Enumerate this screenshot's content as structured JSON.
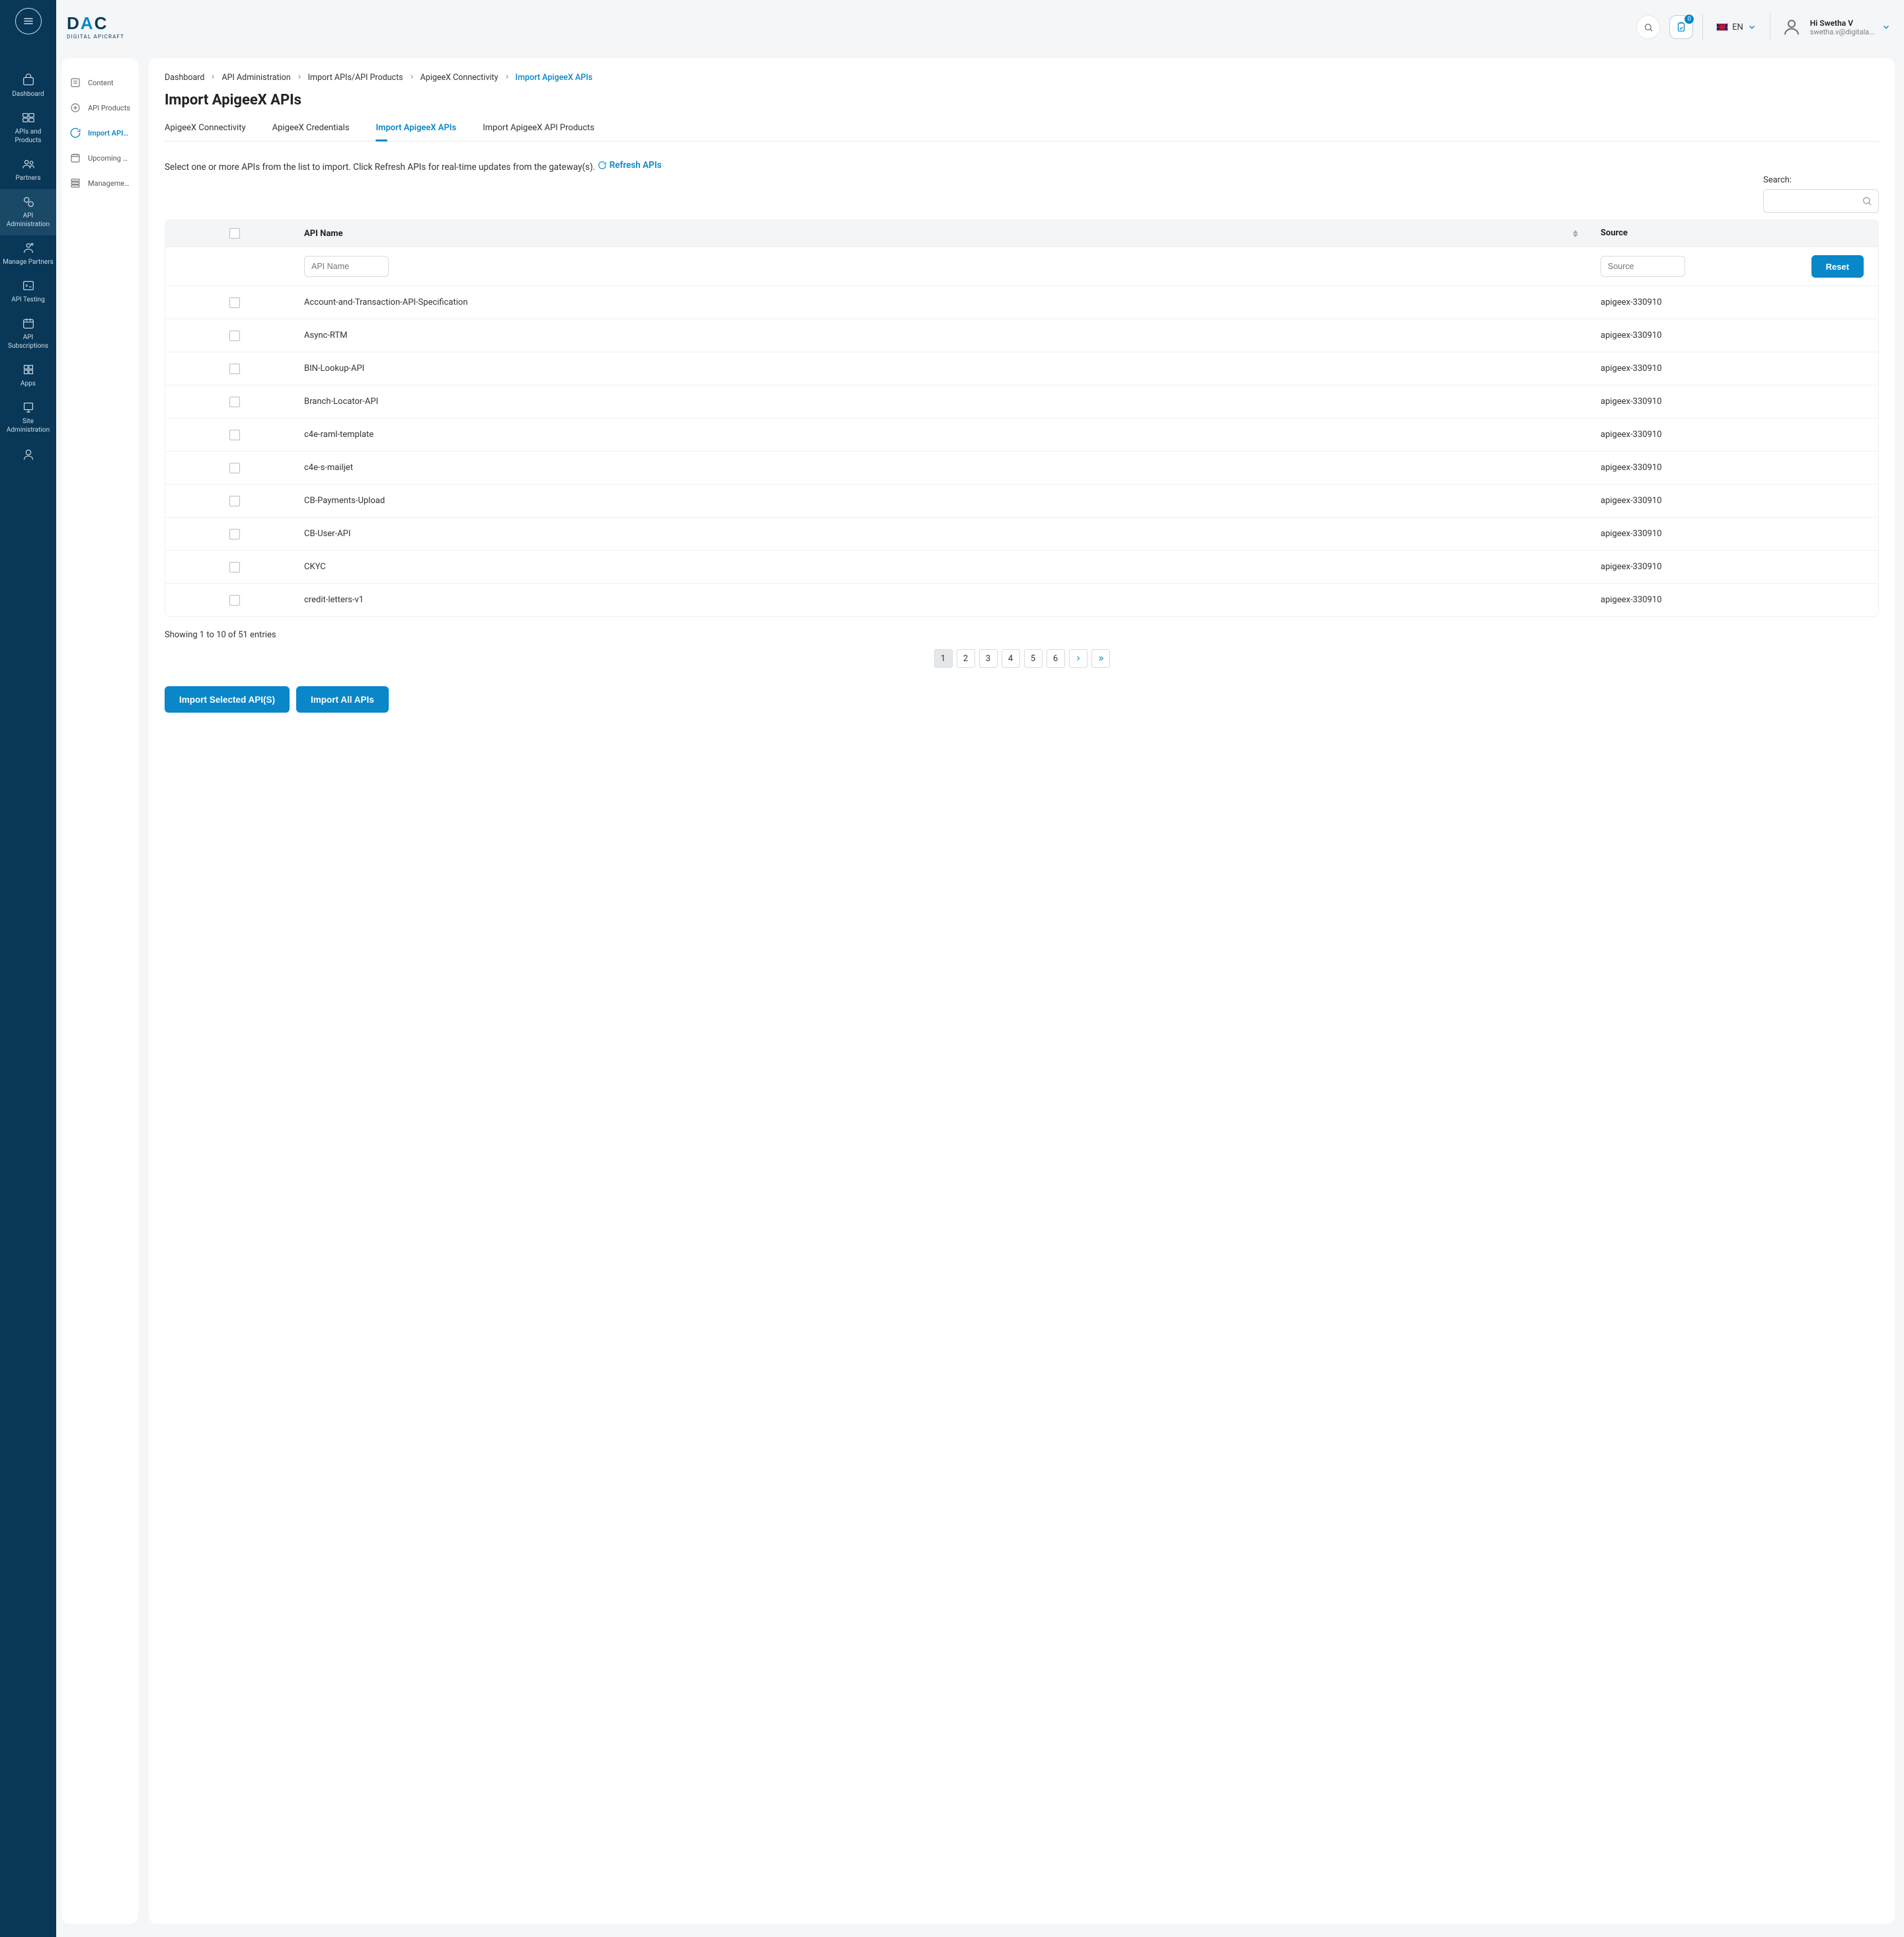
{
  "brand": {
    "name": "DAC",
    "sub": "DIGITAL APICRAFT"
  },
  "topbar": {
    "lang": "EN",
    "notifications": "0",
    "user_greeting": "Hi Swetha V",
    "user_email": "swetha.v@digitala..."
  },
  "primary_nav": {
    "items": [
      {
        "label": "Dashboard"
      },
      {
        "label": "APIs and Products"
      },
      {
        "label": "Partners"
      },
      {
        "label": "API Administration"
      },
      {
        "label": "Manage Partners"
      },
      {
        "label": "API Testing"
      },
      {
        "label": "API Subscriptions"
      },
      {
        "label": "Apps"
      },
      {
        "label": "Site Administration"
      }
    ]
  },
  "secondary_nav": {
    "items": [
      {
        "label": "Content"
      },
      {
        "label": "API Products"
      },
      {
        "label": "Import APIs / ..."
      },
      {
        "label": "Upcoming API ..."
      },
      {
        "label": "Management A..."
      }
    ]
  },
  "breadcrumbs": {
    "items": [
      "Dashboard",
      "API Administration",
      "Import APIs/API Products",
      "ApigeeX Connectivity",
      "Import ApigeeX APIs"
    ]
  },
  "page": {
    "title": "Import ApigeeX APIs",
    "instruction": "Select one or more APIs from the list to import. Click Refresh APIs for real-time updates from the gateway(s).",
    "refresh_label": "Refresh APIs",
    "search_label": "Search:"
  },
  "tabs": {
    "items": [
      "ApigeeX Connectivity",
      "ApigeeX Credentials",
      "Import ApigeeX APIs",
      "Import ApigeeX API Products"
    ],
    "active": 2
  },
  "table": {
    "headers": {
      "name": "API Name",
      "source": "Source"
    },
    "filters": {
      "name_placeholder": "API Name",
      "source_placeholder": "Source",
      "reset": "Reset"
    },
    "rows": [
      {
        "name": "Account-and-Transaction-API-Specification",
        "source": "apigeex-330910"
      },
      {
        "name": "Async-RTM",
        "source": "apigeex-330910"
      },
      {
        "name": "BIN-Lookup-API",
        "source": "apigeex-330910"
      },
      {
        "name": "Branch-Locator-API",
        "source": "apigeex-330910"
      },
      {
        "name": "c4e-raml-template",
        "source": "apigeex-330910"
      },
      {
        "name": "c4e-s-mailjet",
        "source": "apigeex-330910"
      },
      {
        "name": "CB-Payments-Upload",
        "source": "apigeex-330910"
      },
      {
        "name": "CB-User-API",
        "source": "apigeex-330910"
      },
      {
        "name": "CKYC",
        "source": "apigeex-330910"
      },
      {
        "name": "credit-letters-v1",
        "source": "apigeex-330910"
      }
    ],
    "entries_info": "Showing 1 to 10 of 51 entries"
  },
  "pagination": {
    "pages": [
      "1",
      "2",
      "3",
      "4",
      "5",
      "6"
    ],
    "active": 0
  },
  "footer": {
    "import_selected": "Import Selected API(S)",
    "import_all": "Import All APIs"
  }
}
